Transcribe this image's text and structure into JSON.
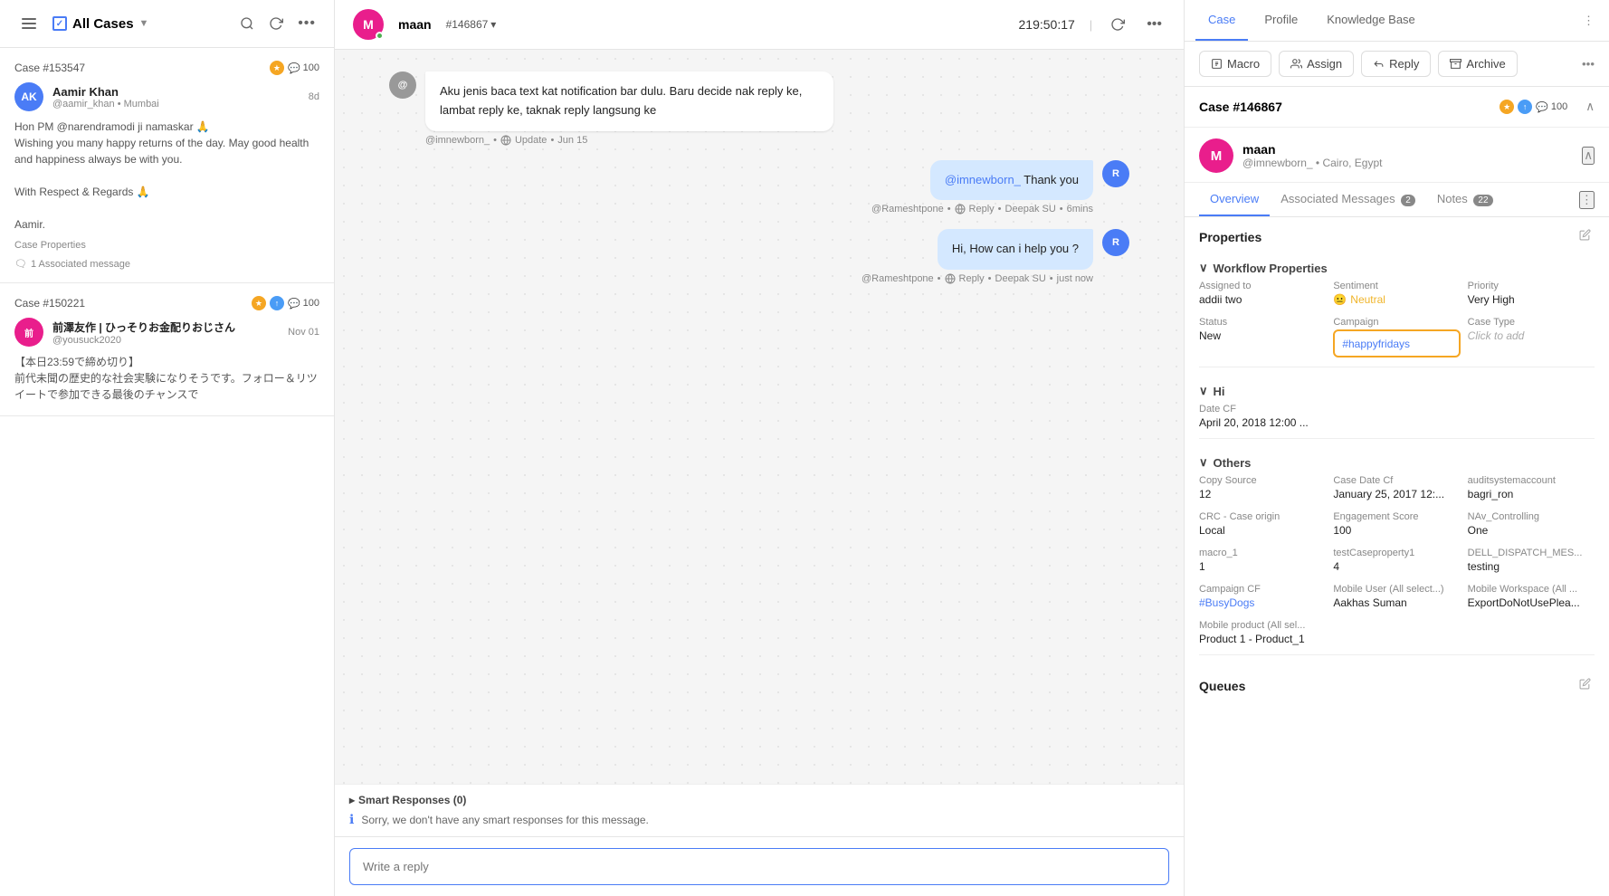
{
  "sidebar": {
    "header_title": "All Cases",
    "hamburger_label": "menu",
    "search_label": "search",
    "refresh_label": "refresh",
    "more_label": "more"
  },
  "cases": [
    {
      "id": "case-1",
      "number": "Case #153547",
      "date": "8d",
      "has_orange_badge": true,
      "msg_count": "100",
      "user_name": "Aamir Khan",
      "user_handle": "@aamir_khan",
      "user_location": "Mumbai",
      "avatar_initials": "AK",
      "avatar_color": "#4a7cf6",
      "message_preview_1": "Hon PM @narendramodi ji namaskar 🙏",
      "message_preview_2": "Wishing you many happy returns of the day. May good health and happiness always be with you.",
      "message_preview_3": "With Respect & Regards 🙏",
      "message_preview_4": "Aamir.",
      "case_props_label": "Case Properties",
      "associated_msg": "1 Associated message"
    },
    {
      "id": "case-2",
      "number": "Case #150221",
      "date": "Nov 01",
      "has_orange_badge": true,
      "has_blue_badge": true,
      "msg_count": "100",
      "user_name": "前澤友作 | ひっそりお金配りおじさん",
      "user_handle": "@yousuck2020",
      "avatar_initials": "前",
      "avatar_color": "#e91e8c",
      "message_preview_1": "【本日23:59で締め切り】",
      "message_preview_2": "前代未聞の歴史的な社会実験になりそうです。フォロー＆リツイートで参加できる最後のチャンスで"
    }
  ],
  "main": {
    "header_avatar_initials": "M",
    "header_name": "maan",
    "case_id": "#146867",
    "timer": "219:50:17",
    "messages": [
      {
        "id": "msg-1",
        "type": "left",
        "text": "Aku jenis baca text kat notification bar dulu. Baru decide nak reply ke, lambat reply ke, taknak reply langsung ke",
        "sender": "@imnewborn_",
        "action": "Update",
        "time": "Jun 15"
      },
      {
        "id": "msg-2",
        "type": "right",
        "mention": "@imnewborn_",
        "text": " Thank you",
        "sender": "@Rameshtpone",
        "action": "Reply",
        "agent": "Deepak SU",
        "time": "6mins"
      },
      {
        "id": "msg-3",
        "type": "right",
        "text": "Hi, How can i help you ?",
        "sender": "@Rameshtpone",
        "action": "Reply",
        "agent": "Deepak SU",
        "time": "just now"
      }
    ],
    "smart_responses_label": "Smart Responses (0)",
    "smart_responses_text": "Sorry, we don't have any smart responses for this message.",
    "reply_placeholder": "Write a reply"
  },
  "right_panel": {
    "tabs": [
      {
        "label": "Case",
        "active": true
      },
      {
        "label": "Profile",
        "active": false
      },
      {
        "label": "Knowledge Base",
        "active": false
      }
    ],
    "actions": [
      {
        "label": "Macro",
        "icon": "macro"
      },
      {
        "label": "Assign",
        "icon": "assign"
      },
      {
        "label": "Reply",
        "icon": "reply"
      },
      {
        "label": "Archive",
        "icon": "archive"
      }
    ],
    "case_number": "Case #146867",
    "msg_count": "100",
    "contact": {
      "name": "maan",
      "handle": "@imnewborn_",
      "location": "Cairo, Egypt",
      "avatar_initials": "M"
    },
    "overview_tabs": [
      {
        "label": "Overview",
        "active": true,
        "badge": null
      },
      {
        "label": "Associated Messages",
        "active": false,
        "badge": "2"
      },
      {
        "label": "Notes",
        "active": false,
        "badge": "22"
      }
    ],
    "properties": {
      "section_label": "Properties",
      "workflow_section": "Workflow Properties",
      "assigned_to_label": "Assigned to",
      "assigned_to_value": "addii two",
      "sentiment_label": "Sentiment",
      "sentiment_value": "Neutral",
      "priority_label": "Priority",
      "priority_value": "Very High",
      "status_label": "Status",
      "status_value": "New",
      "campaign_label": "Campaign",
      "campaign_value": "#happyfridays",
      "case_type_label": "Case Type",
      "case_type_value": "Click to add",
      "hi_section": "Hi",
      "date_cf_label": "Date CF",
      "date_cf_value": "April 20, 2018 12:00 ...",
      "others_section": "Others",
      "copy_source_label": "Copy Source",
      "copy_source_value": "12",
      "case_date_cf_label": "Case Date Cf",
      "case_date_cf_value": "January 25, 2017 12:...",
      "audit_label": "auditsystemaccount",
      "audit_value": "bagri_ron",
      "crc_label": "CRC - Case origin",
      "crc_value": "Local",
      "engagement_label": "Engagement Score",
      "engagement_value": "100",
      "nav_label": "NAv_Controlling",
      "nav_value": "One",
      "macro1_label": "macro_1",
      "macro1_value": "1",
      "test_label": "testCaseproperty1",
      "test_value": "4",
      "dell_label": "DELL_DISPATCH_MES...",
      "dell_value": "testing",
      "campaign_cf_label": "Campaign CF",
      "campaign_cf_value": "#BusyDogs",
      "mobile_user_label": "Mobile User (All select...)",
      "mobile_user_value": "Aakhas Suman",
      "mobile_ws_label": "Mobile Workspace (All ...",
      "mobile_ws_value": "ExportDoNotUsePlea...",
      "mobile_product_label": "Mobile product (All sel...",
      "mobile_product_value": "Product 1 - Product_1",
      "queues_label": "Queues"
    }
  }
}
